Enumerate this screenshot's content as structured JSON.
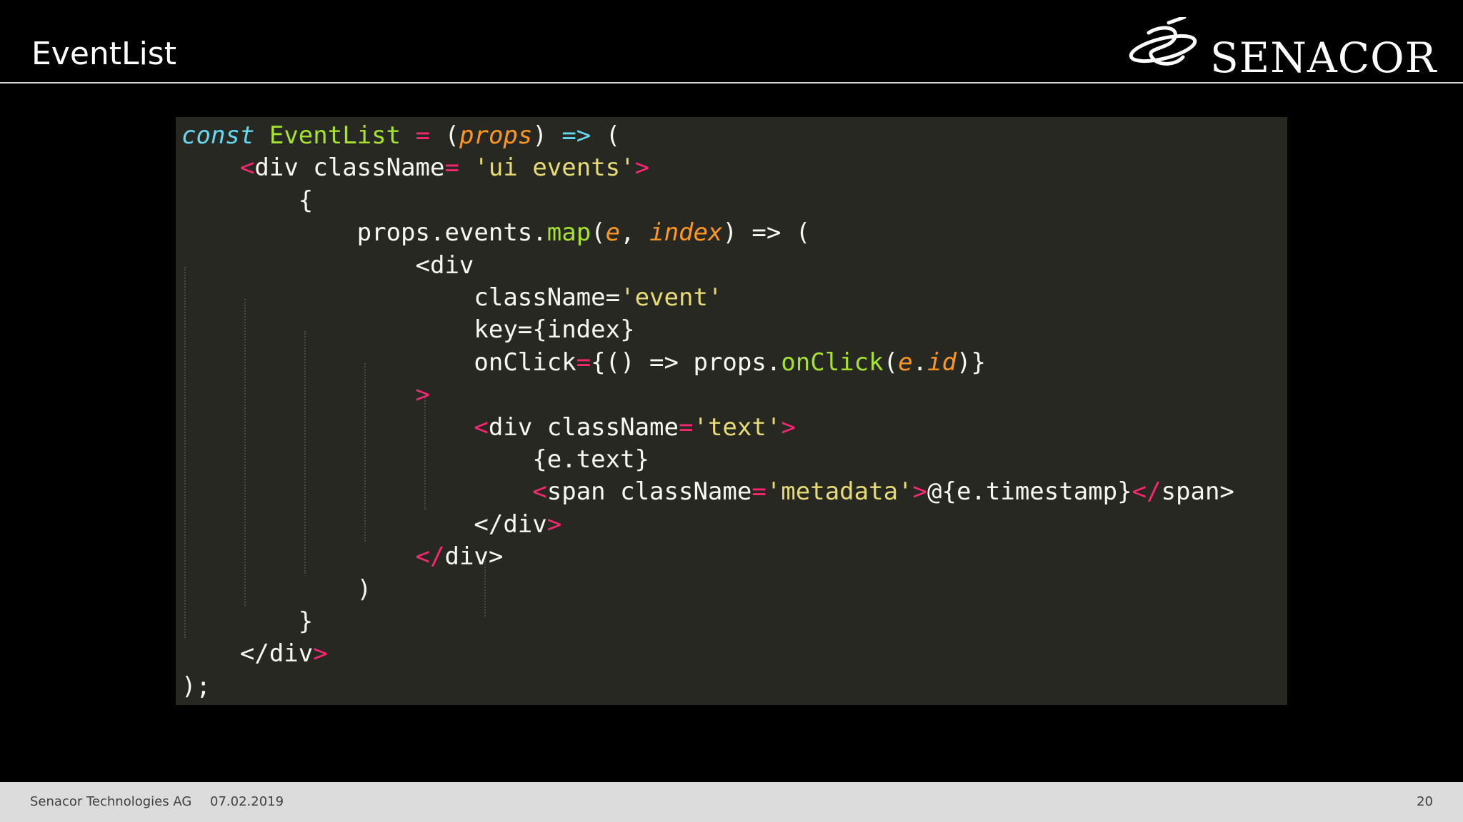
{
  "slide": {
    "title": "EventList",
    "page_number": "20"
  },
  "logo": {
    "wordmark": "SENACOR"
  },
  "footer": {
    "company": "Senacor Technologies AG",
    "date": "07.02.2019",
    "page": "20"
  },
  "colors": {
    "background": "#000000",
    "code_background": "#272822",
    "keyword": "#66d9ef",
    "function": "#a6e22e",
    "operator": "#f92672",
    "parameter": "#fd971f",
    "string": "#e6db74",
    "text": "#f8f8f2",
    "footer_background": "#dcdcdc"
  },
  "code": {
    "language": "jsx",
    "lines": [
      [
        [
          "kw",
          "const"
        ],
        [
          "text",
          " "
        ],
        [
          "fn",
          "EventList"
        ],
        [
          "text",
          " "
        ],
        [
          "op",
          "="
        ],
        [
          "text",
          " ("
        ],
        [
          "param",
          "props"
        ],
        [
          "text",
          ") "
        ],
        [
          "kw",
          "=>"
        ],
        [
          "text",
          " ("
        ]
      ],
      [
        [
          "text",
          "    "
        ],
        [
          "op",
          "<"
        ],
        [
          "text",
          "div className"
        ],
        [
          "op",
          "="
        ],
        [
          "text",
          " "
        ],
        [
          "str",
          "'ui events'"
        ],
        [
          "op",
          ">"
        ]
      ],
      [
        [
          "text",
          "        {"
        ]
      ],
      [
        [
          "text",
          "            props.events."
        ],
        [
          "fn",
          "map"
        ],
        [
          "text",
          "("
        ],
        [
          "param",
          "e"
        ],
        [
          "text",
          ", "
        ],
        [
          "param",
          "index"
        ],
        [
          "text",
          ") => ("
        ]
      ],
      [
        [
          "text",
          "                <div"
        ]
      ],
      [
        [
          "text",
          "                    className="
        ],
        [
          "str",
          "'event'"
        ]
      ],
      [
        [
          "text",
          "                    key={index}"
        ]
      ],
      [
        [
          "text",
          "                    onClick"
        ],
        [
          "op",
          "="
        ],
        [
          "text",
          "{() => props."
        ],
        [
          "fn",
          "onClick"
        ],
        [
          "text",
          "("
        ],
        [
          "param",
          "e"
        ],
        [
          "text",
          "."
        ],
        [
          "param",
          "id"
        ],
        [
          "text",
          ")}"
        ]
      ],
      [
        [
          "text",
          "                "
        ],
        [
          "op",
          ">"
        ]
      ],
      [
        [
          "text",
          "                    "
        ],
        [
          "op",
          "<"
        ],
        [
          "text",
          "div className"
        ],
        [
          "op",
          "="
        ],
        [
          "str",
          "'text'"
        ],
        [
          "op",
          ">"
        ]
      ],
      [
        [
          "text",
          "                        {e.text}"
        ]
      ],
      [
        [
          "text",
          "                        "
        ],
        [
          "op",
          "<"
        ],
        [
          "text",
          "span className"
        ],
        [
          "op",
          "="
        ],
        [
          "str",
          "'metadata'"
        ],
        [
          "op",
          ">"
        ],
        [
          "text",
          "@{e.timestamp}"
        ],
        [
          "op",
          "</"
        ],
        [
          "text",
          "span>"
        ]
      ],
      [
        [
          "text",
          "                    </div"
        ],
        [
          "op",
          ">"
        ]
      ],
      [
        [
          "text",
          "                "
        ],
        [
          "op",
          "</"
        ],
        [
          "text",
          "div>"
        ]
      ],
      [
        [
          "text",
          "            )"
        ]
      ],
      [
        [
          "text",
          "        }"
        ]
      ],
      [
        [
          "text",
          "    </div"
        ],
        [
          "op",
          ">"
        ]
      ],
      [
        [
          "text",
          ");"
        ]
      ]
    ]
  }
}
